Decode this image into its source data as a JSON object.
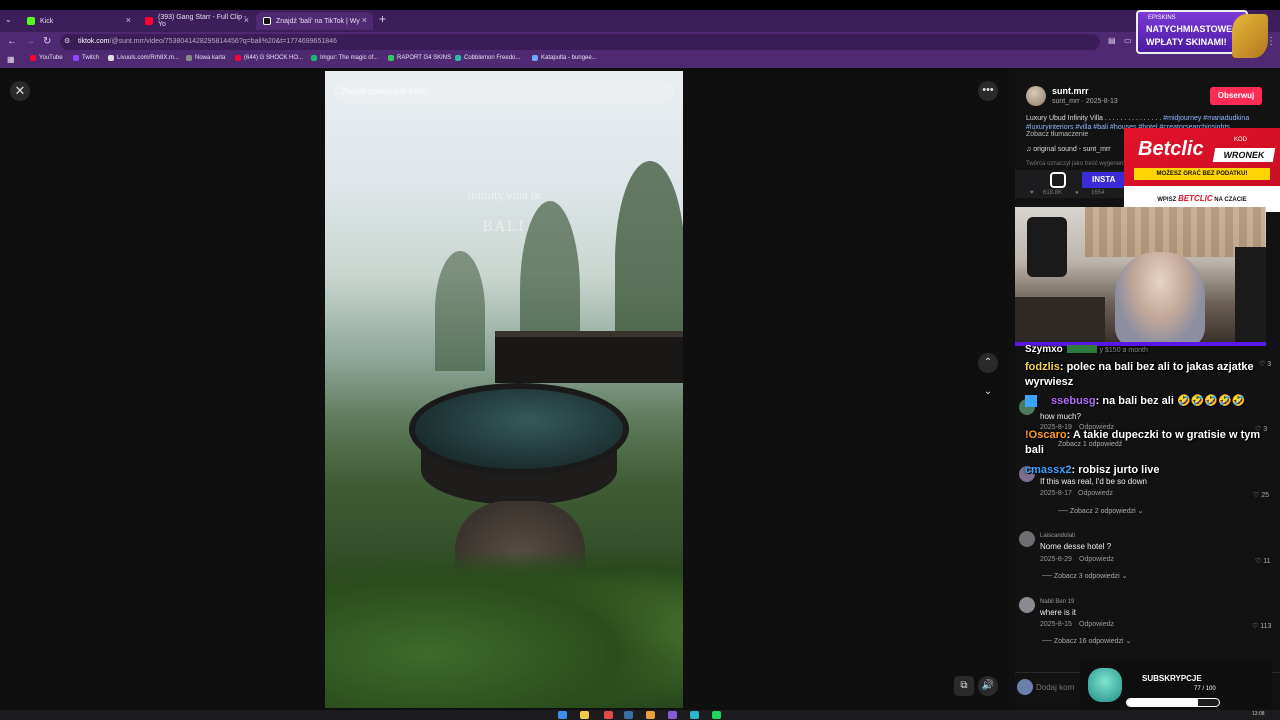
{
  "tabs": [
    {
      "label": "Kick",
      "color": "#53fc18"
    },
    {
      "label": "(393) Gang Starr - Full Clip - Yo",
      "color": "#ff0033"
    },
    {
      "label": "Znajdź 'bali' na TikTok | Wy",
      "color": "#ffffff"
    }
  ],
  "address": {
    "host": "tiktok.com",
    "rest": "/@sunt.mrr/video/7538041428295814456?q=bali%20&t=1774699651846"
  },
  "bookmarks": [
    {
      "label": "YouTube",
      "color": "#ff0033"
    },
    {
      "label": "Twitch",
      "color": "#9146ff"
    },
    {
      "label": "Livuuls.com/Rrh8X.m...",
      "color": "#dddddd"
    },
    {
      "label": "Nowa karta",
      "color": "#888888"
    },
    {
      "label": "(644) G SHOCK HO...",
      "color": "#ff0033"
    },
    {
      "label": "Imgur: The magic of...",
      "color": "#1bb76e"
    },
    {
      "label": "RAPORT G4 SKINS",
      "color": "#35c759"
    },
    {
      "label": "Cobblemon Freedo...",
      "color": "#2fb6a8"
    },
    {
      "label": "Katapulta - bungee...",
      "color": "#6ea8ff"
    }
  ],
  "search": {
    "placeholder": "Znajdź powiązane treści"
  },
  "video": {
    "overlay_title": "Infinity villa in",
    "overlay_sub": "BALI"
  },
  "author": {
    "name": "sunt.mrr",
    "meta": "sunt_mrr · 2025-8-13",
    "follow_label": "Obserwuj"
  },
  "description": {
    "text": "Luxury Ubud Infinity Villa . . . . . . . . . . . . . . .",
    "tags_1": "#midjourney #mariadudkina",
    "tags_2": "#luxuryinteriors #villa #bali #houses #hotel #creatorsearchinsights",
    "translate": "Zobacz tłumaczenie",
    "sound": "♫ original sound - sunt_mrr",
    "created": "Twórca oznaczył jako treść wygenerowaną przez AI"
  },
  "insta": {
    "label": "INSTA",
    "stat_1": "618.8K",
    "stat_2": "1654"
  },
  "ad_betclic": {
    "logo": "Betclic",
    "kod": "KOD",
    "code": "WRONEK",
    "promo": "MOŻESZ GRAĆ BEZ PODATKU!",
    "footer_a": "WPISZ",
    "footer_b": "BETCLIC",
    "footer_c": "NA CZACIE"
  },
  "promo": {
    "brand": "EPISKINS",
    "line1": "NATYCHMIASTOWE",
    "line2": "WPŁATY SKINAMI!"
  },
  "chat": [
    {
      "user": "Szymxo",
      "text": "",
      "user_color": "#ffffff",
      "meta": "y $150 a month"
    },
    {
      "user": "fodzlis",
      "text": ": polec na bali bez ali to jakas azjatke wyrwiesz",
      "user_color": "#f3d34a"
    },
    {
      "user": "ssebusg",
      "text": ": na bali bez ali 🤣🤣🤣🤣🤣",
      "user_color": "#b46cff"
    },
    {
      "user": "!Oscaro",
      "text": ": A takie dupeczki to w gratisie w tym bali",
      "user_color": "#ff9d2a"
    },
    {
      "user": "cmassx2",
      "text": ": robisz jurto live",
      "user_color": "#3aa4ff"
    }
  ],
  "comments_bg": [
    {
      "text": "how much?",
      "date": "2025-8-19",
      "reply": "Odpowiedz",
      "likes": "3",
      "replies": "Zobacz 1 odpowiedź"
    },
    {
      "text": "If this was real, I'd be so down",
      "date": "2025-8-17",
      "reply": "Odpowiedz",
      "likes": "25",
      "replies": "Zobacz 2 odpowiedzi"
    }
  ],
  "comments": [
    {
      "name": "Laiscandolati",
      "text": "Nome desse hotel ?",
      "date": "2025-8-29",
      "reply": "Odpowiedz",
      "likes": "11",
      "replies": "Zobacz 3 odpowiedzi"
    },
    {
      "name": "Nabil Ben 19",
      "text": "where is it",
      "date": "2025-8-15",
      "reply": "Odpowiedz",
      "likes": "113",
      "replies": "Zobacz 16 odpowiedzi"
    }
  ],
  "misc_likes": {
    "a": "3",
    "b": "3"
  },
  "comment_input": {
    "placeholder": "Dodaj kom"
  },
  "subs": {
    "title": "SUBSKRYPCJE",
    "count": "77 / 100",
    "current": 77,
    "goal": 100
  },
  "clock": "13:08"
}
